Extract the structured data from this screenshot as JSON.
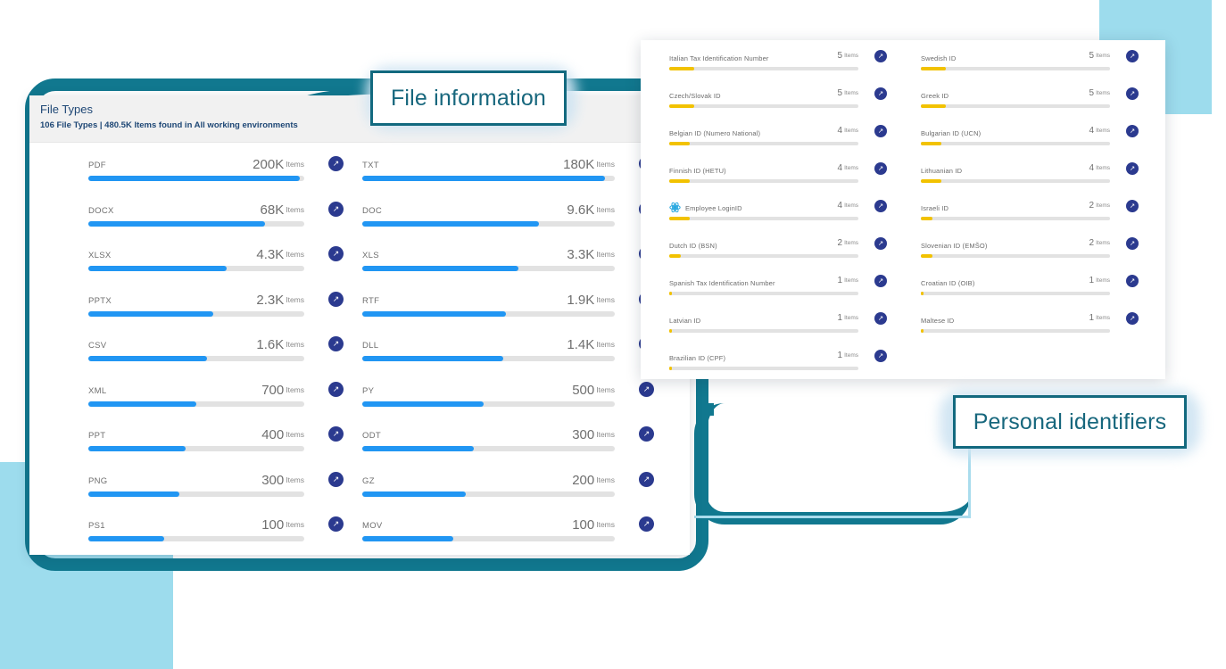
{
  "callouts": {
    "file_information": "File information",
    "personal_identifiers": "Personal identifiers"
  },
  "colors": {
    "teal_frame": "#11788f",
    "light_blue_block": "#9ddced",
    "callout_border": "#12697f",
    "callout_text": "#17677d",
    "file_bar_fill": "#2196f3",
    "pii_bar_fill": "#f2c200",
    "bar_track": "#e2e2e2",
    "go_button": "#2b3a8f",
    "panel_header_bg": "#f1f1f1",
    "panel_header_text": "#1e4775"
  },
  "file_panel": {
    "title": "File Types",
    "subtitle": "106 File Types  |  480.5K Items found in All working environments",
    "unit": "Items",
    "go_icon": "arrow-up-right-icon",
    "left_column": [
      {
        "label": "PDF",
        "value": "200K",
        "pct": 98
      },
      {
        "label": "DOCX",
        "value": "68K",
        "pct": 82
      },
      {
        "label": "XLSX",
        "value": "4.3K",
        "pct": 64
      },
      {
        "label": "PPTX",
        "value": "2.3K",
        "pct": 58
      },
      {
        "label": "CSV",
        "value": "1.6K",
        "pct": 55
      },
      {
        "label": "XML",
        "value": "700",
        "pct": 50
      },
      {
        "label": "PPT",
        "value": "400",
        "pct": 45
      },
      {
        "label": "PNG",
        "value": "300",
        "pct": 42
      },
      {
        "label": "PS1",
        "value": "100",
        "pct": 35
      }
    ],
    "right_column": [
      {
        "label": "TXT",
        "value": "180K",
        "pct": 96
      },
      {
        "label": "DOC",
        "value": "9.6K",
        "pct": 70
      },
      {
        "label": "XLS",
        "value": "3.3K",
        "pct": 62
      },
      {
        "label": "RTF",
        "value": "1.9K",
        "pct": 57
      },
      {
        "label": "DLL",
        "value": "1.4K",
        "pct": 56
      },
      {
        "label": "PY",
        "value": "500",
        "pct": 48
      },
      {
        "label": "ODT",
        "value": "300",
        "pct": 44
      },
      {
        "label": "GZ",
        "value": "200",
        "pct": 41
      },
      {
        "label": "MOV",
        "value": "100",
        "pct": 36
      }
    ]
  },
  "pii_panel": {
    "unit": "Items",
    "go_icon": "arrow-up-right-icon",
    "left_column": [
      {
        "label": "Italian Tax Identification Number",
        "value": "5",
        "pct": 13
      },
      {
        "label": "Czech/Slovak ID",
        "value": "5",
        "pct": 13
      },
      {
        "label": "Belgian ID (Numero National)",
        "value": "4",
        "pct": 11
      },
      {
        "label": "Finnish ID (HETU)",
        "value": "4",
        "pct": 11
      },
      {
        "label": "Employee LoginID",
        "value": "4",
        "pct": 11,
        "icon": "employee-login-icon"
      },
      {
        "label": "Dutch ID (BSN)",
        "value": "2",
        "pct": 6
      },
      {
        "label": "Spanish Tax Identification Number",
        "value": "1",
        "pct": 1.4
      },
      {
        "label": "Latvian ID",
        "value": "1",
        "pct": 1.4
      },
      {
        "label": "Brazilian ID (CPF)",
        "value": "1",
        "pct": 1.4
      }
    ],
    "right_column": [
      {
        "label": "Swedish ID",
        "value": "5",
        "pct": 13
      },
      {
        "label": "Greek ID",
        "value": "5",
        "pct": 13
      },
      {
        "label": "Bulgarian ID (UCN)",
        "value": "4",
        "pct": 11
      },
      {
        "label": "Lithuanian ID",
        "value": "4",
        "pct": 11
      },
      {
        "label": "Israeli ID",
        "value": "2",
        "pct": 6
      },
      {
        "label": "Slovenian ID (EMŠO)",
        "value": "2",
        "pct": 6
      },
      {
        "label": "Croatian ID (OIB)",
        "value": "1",
        "pct": 1.4
      },
      {
        "label": "Maltese ID",
        "value": "1",
        "pct": 1.4
      }
    ]
  }
}
